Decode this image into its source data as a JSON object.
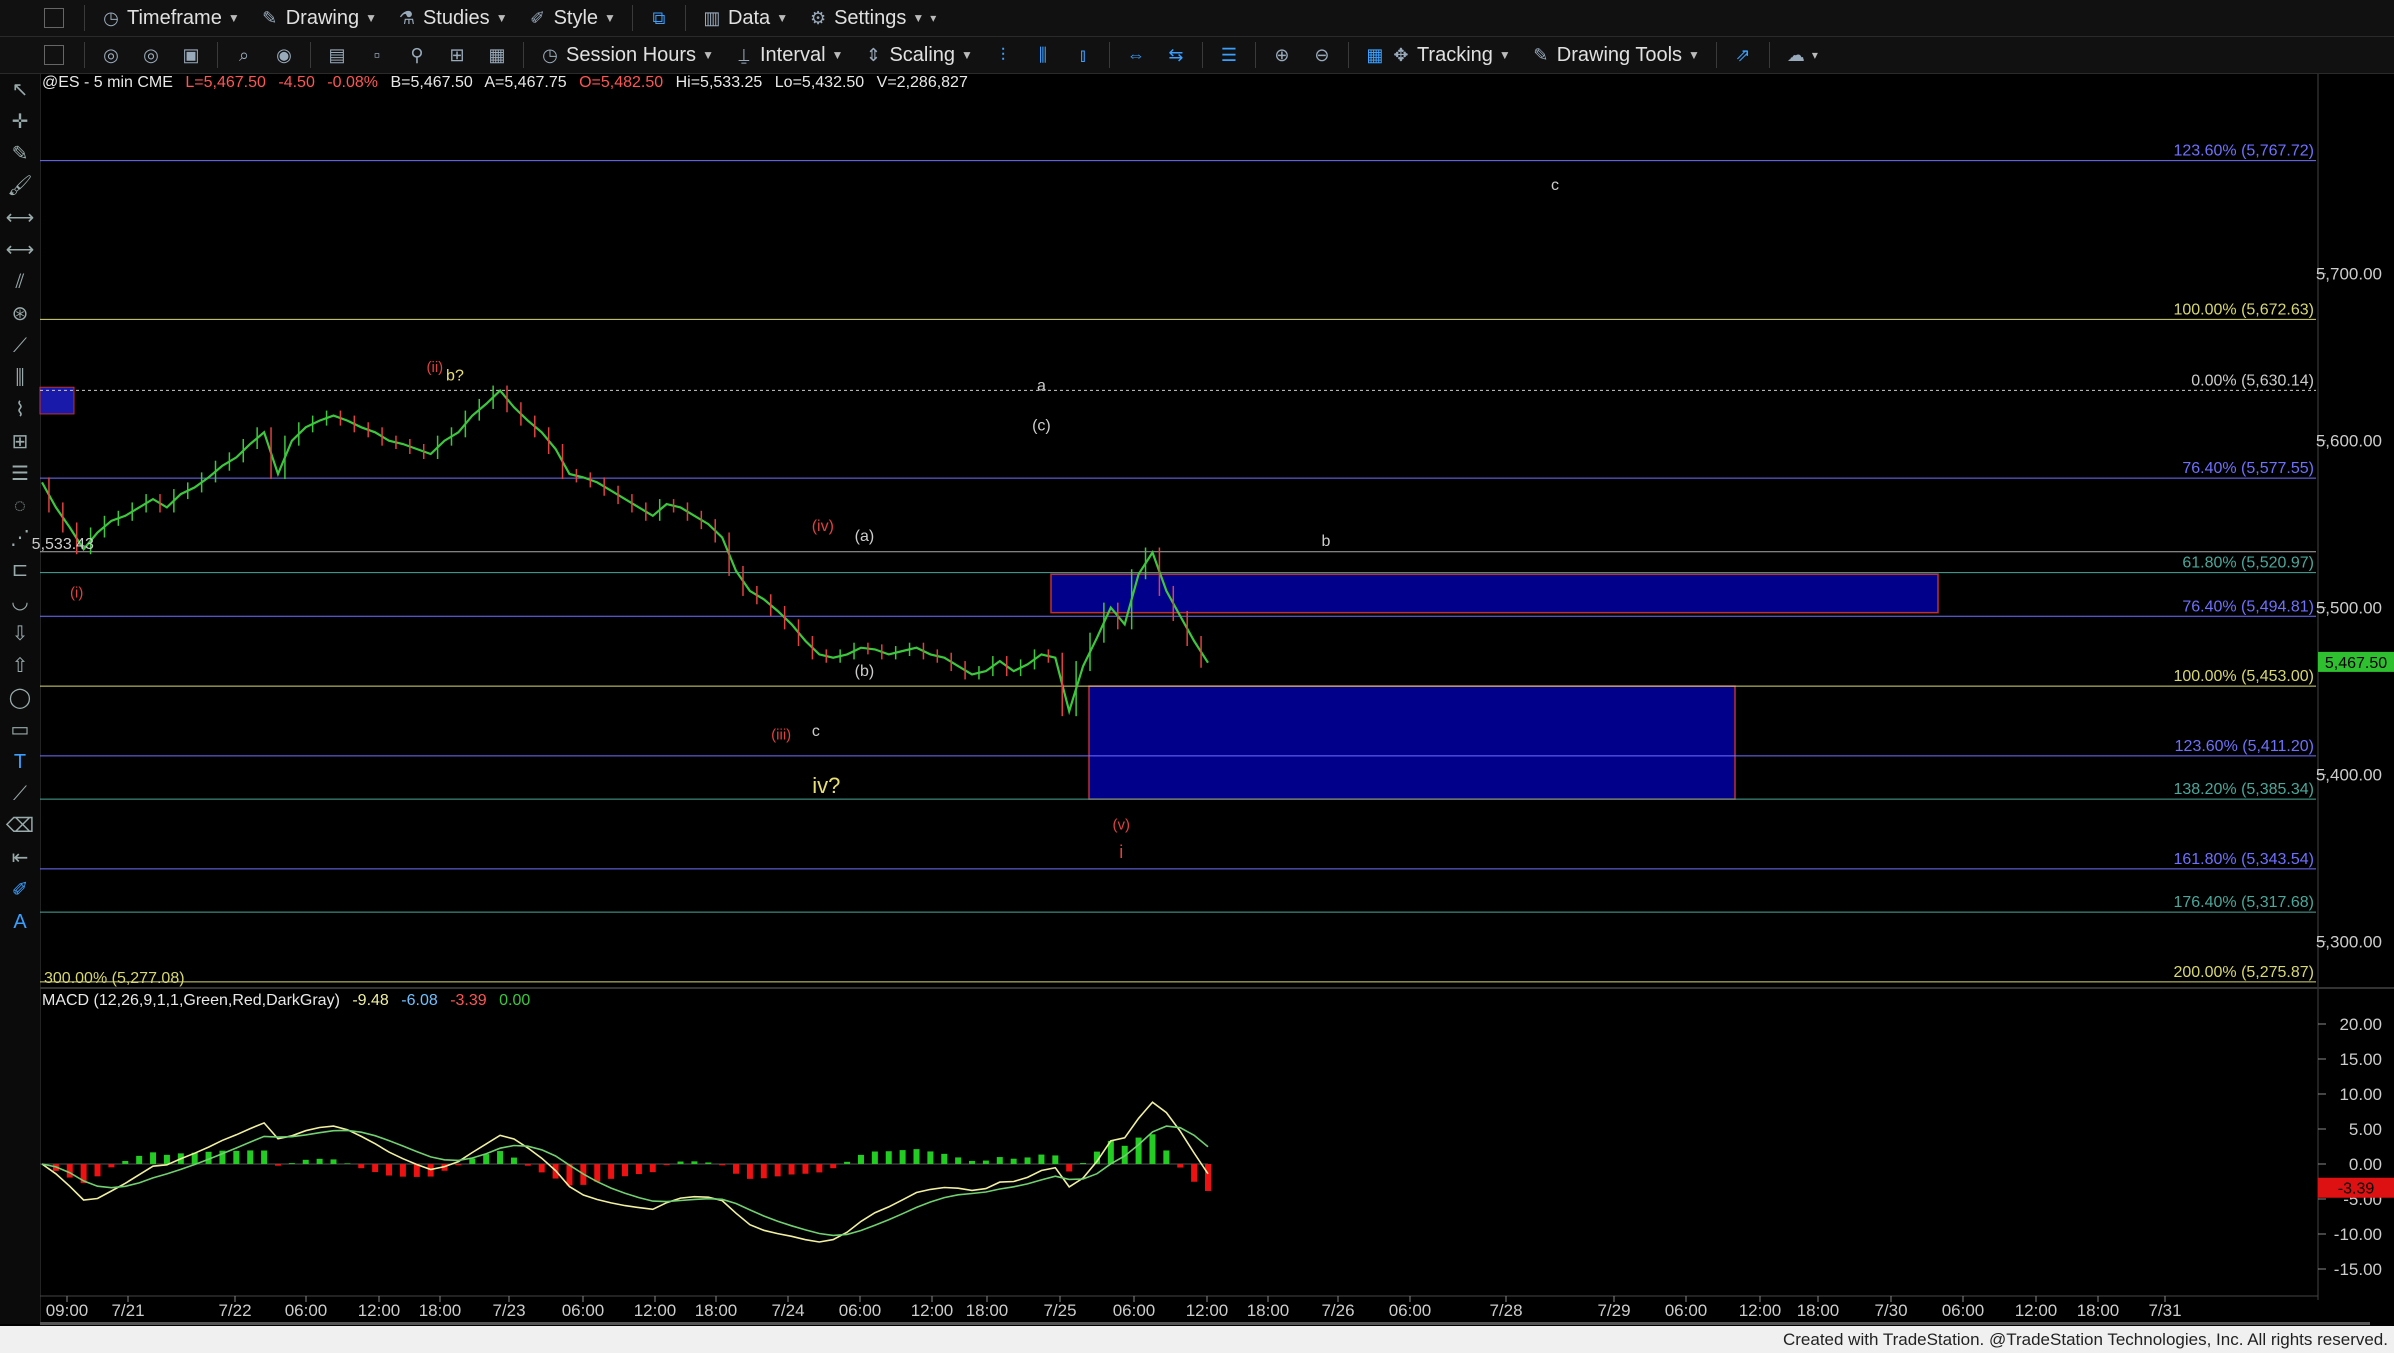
{
  "toolbar": {
    "timeframe": "Timeframe",
    "drawing": "Drawing",
    "studies": "Studies",
    "style": "Style",
    "data": "Data",
    "settings": "Settings",
    "session_hours": "Session Hours",
    "interval": "Interval",
    "scaling": "Scaling",
    "tracking": "Tracking",
    "drawing_tools": "Drawing Tools"
  },
  "symbol_bar": {
    "symbol": "@ES - 5 min  CME",
    "last": "L=5,467.50",
    "change": "-4.50",
    "change_pct": "-0.08%",
    "bid": "B=5,467.50",
    "ask": "A=5,467.75",
    "open": "O=5,482.50",
    "high": "Hi=5,533.25",
    "low": "Lo=5,432.50",
    "volume": "V=2,286,827"
  },
  "macd_bar": {
    "label": "MACD (12,26,9,1,1,Green,Red,DarkGray)",
    "macd": "-9.48",
    "signal": "-6.08",
    "hist": "-3.39",
    "zero": "0.00"
  },
  "status_text": "Created with TradeStation. @TradeStation Technologies, Inc. All rights reserved.",
  "colors": {
    "up_candle": "#3cc83c",
    "down_candle": "#e04040",
    "fib_blue": "#7070ff",
    "fib_yellow": "#d8d870",
    "fib_teal": "#4aa89a",
    "box_fill": "#00008b",
    "hist_pos": "#22cc22",
    "hist_neg": "#ee1111",
    "macd_line": "#f0f0a0",
    "signal_line": "#70d070"
  },
  "chart_data": [
    {
      "type": "candlestick",
      "x_ticks": [
        "09:00",
        "7/21",
        "7/22",
        "06:00",
        "12:00",
        "18:00",
        "7/23",
        "06:00",
        "12:00",
        "18:00",
        "7/24",
        "06:00",
        "12:00",
        "18:00",
        "7/25",
        "06:00",
        "12:00",
        "18:00",
        "7/26",
        "06:00",
        "7/28",
        "7/29",
        "06:00",
        "12:00",
        "18:00",
        "7/30",
        "06:00",
        "12:00",
        "18:00",
        "7/31"
      ],
      "y_ticks": [
        "5,700.00",
        "5,600.00",
        "5,500.00",
        "5,400.00",
        "5,300.00"
      ],
      "ylim": [
        5274,
        5810
      ],
      "last_price_label": "5,467.50",
      "price_path": [
        [
          0,
          5575
        ],
        [
          2,
          5560
        ],
        [
          4,
          5548
        ],
        [
          6,
          5535
        ],
        [
          8,
          5545
        ],
        [
          10,
          5552
        ],
        [
          12,
          5555
        ],
        [
          14,
          5560
        ],
        [
          16,
          5565
        ],
        [
          18,
          5560
        ],
        [
          20,
          5568
        ],
        [
          22,
          5572
        ],
        [
          24,
          5578
        ],
        [
          26,
          5585
        ],
        [
          28,
          5590
        ],
        [
          30,
          5598
        ],
        [
          32,
          5605
        ],
        [
          34,
          5580
        ],
        [
          36,
          5600
        ],
        [
          38,
          5608
        ],
        [
          40,
          5612
        ],
        [
          42,
          5615
        ],
        [
          44,
          5612
        ],
        [
          46,
          5608
        ],
        [
          48,
          5605
        ],
        [
          50,
          5600
        ],
        [
          52,
          5598
        ],
        [
          54,
          5595
        ],
        [
          56,
          5592
        ],
        [
          58,
          5600
        ],
        [
          60,
          5605
        ],
        [
          62,
          5615
        ],
        [
          64,
          5622
        ],
        [
          66,
          5630
        ],
        [
          68,
          5620
        ],
        [
          70,
          5612
        ],
        [
          72,
          5605
        ],
        [
          74,
          5595
        ],
        [
          76,
          5580
        ],
        [
          78,
          5578
        ],
        [
          80,
          5575
        ],
        [
          82,
          5570
        ],
        [
          84,
          5565
        ],
        [
          86,
          5560
        ],
        [
          88,
          5555
        ],
        [
          90,
          5562
        ],
        [
          92,
          5560
        ],
        [
          94,
          5555
        ],
        [
          96,
          5550
        ],
        [
          98,
          5542
        ],
        [
          100,
          5522
        ],
        [
          102,
          5510
        ],
        [
          104,
          5505
        ],
        [
          106,
          5498
        ],
        [
          108,
          5490
        ],
        [
          110,
          5480
        ],
        [
          112,
          5472
        ],
        [
          114,
          5470
        ],
        [
          116,
          5472
        ],
        [
          118,
          5476
        ],
        [
          120,
          5475
        ],
        [
          122,
          5472
        ],
        [
          124,
          5474
        ],
        [
          126,
          5476
        ],
        [
          128,
          5472
        ],
        [
          130,
          5470
        ],
        [
          132,
          5465
        ],
        [
          134,
          5460
        ],
        [
          136,
          5462
        ],
        [
          138,
          5468
        ],
        [
          140,
          5462
        ],
        [
          142,
          5466
        ],
        [
          144,
          5472
        ],
        [
          146,
          5470
        ],
        [
          148,
          5438
        ],
        [
          150,
          5465
        ],
        [
          152,
          5482
        ],
        [
          154,
          5500
        ],
        [
          156,
          5490
        ],
        [
          158,
          5520
        ],
        [
          160,
          5533
        ],
        [
          162,
          5510
        ],
        [
          164,
          5495
        ],
        [
          166,
          5480
        ],
        [
          168,
          5467
        ]
      ],
      "fib_levels": [
        {
          "label": "123.60% (5,767.72)",
          "value": 5767.72,
          "color": "#7070ff"
        },
        {
          "label": "100.00% (5,672.63)",
          "value": 5672.63,
          "color": "#d8d870"
        },
        {
          "label": "0.00% (5,630.14)",
          "value": 5630.14,
          "color": "#cccccc"
        },
        {
          "label": "76.40% (5,577.55)",
          "value": 5577.55,
          "color": "#7070ff"
        },
        {
          "label": "61.80% (5,520.97)",
          "value": 5520.97,
          "color": "#4aa89a"
        },
        {
          "label": "76.40% (5,494.81)",
          "value": 5494.81,
          "color": "#7070ff"
        },
        {
          "label": "100.00% (5,453.00)",
          "value": 5453.0,
          "color": "#d8d870"
        },
        {
          "label": "123.60% (5,411.20)",
          "value": 5411.2,
          "color": "#7070ff"
        },
        {
          "label": "138.20% (5,385.34)",
          "value": 5385.34,
          "color": "#4aa89a"
        },
        {
          "label": "161.80% (5,343.54)",
          "value": 5343.54,
          "color": "#7070ff"
        },
        {
          "label": "176.40% (5,317.68)",
          "value": 5317.68,
          "color": "#4aa89a"
        },
        {
          "label": "200.00% (5,275.87)",
          "value": 5275.87,
          "color": "#d8d870"
        },
        {
          "label": "300.00% (5,277.08)",
          "value": 5277.08,
          "color": "#d8d870"
        }
      ],
      "annotations": [
        {
          "text": "(ii)",
          "color": "#e04040"
        },
        {
          "text": "b?",
          "color": "#e8e070"
        },
        {
          "text": "(i)",
          "color": "#e04040"
        },
        {
          "text": "5,533.43",
          "color": "#cccccc"
        },
        {
          "text": "(iv)",
          "color": "#e04040"
        },
        {
          "text": "(a)",
          "color": "#cccccc"
        },
        {
          "text": "(b)",
          "color": "#cccccc"
        },
        {
          "text": "(iii)",
          "color": "#e04040"
        },
        {
          "text": "c",
          "color": "#cccccc"
        },
        {
          "text": "iv?",
          "color": "#e8e070"
        },
        {
          "text": "a",
          "color": "#cccccc"
        },
        {
          "text": "(c)",
          "color": "#cccccc"
        },
        {
          "text": "b",
          "color": "#cccccc"
        },
        {
          "text": "c",
          "color": "#cccccc"
        },
        {
          "text": "(v)",
          "color": "#e04040"
        },
        {
          "text": "i",
          "color": "#e04040"
        }
      ]
    },
    {
      "type": "line",
      "title": "MACD (12,26,9,1,1,Green,Red,DarkGray)",
      "y_ticks": [
        "20.00",
        "15.00",
        "10.00",
        "5.00",
        "0.00",
        "-5.00",
        "-10.00",
        "-15.00"
      ],
      "ylim": [
        -18,
        22
      ],
      "current_label": "-3.39"
    }
  ]
}
